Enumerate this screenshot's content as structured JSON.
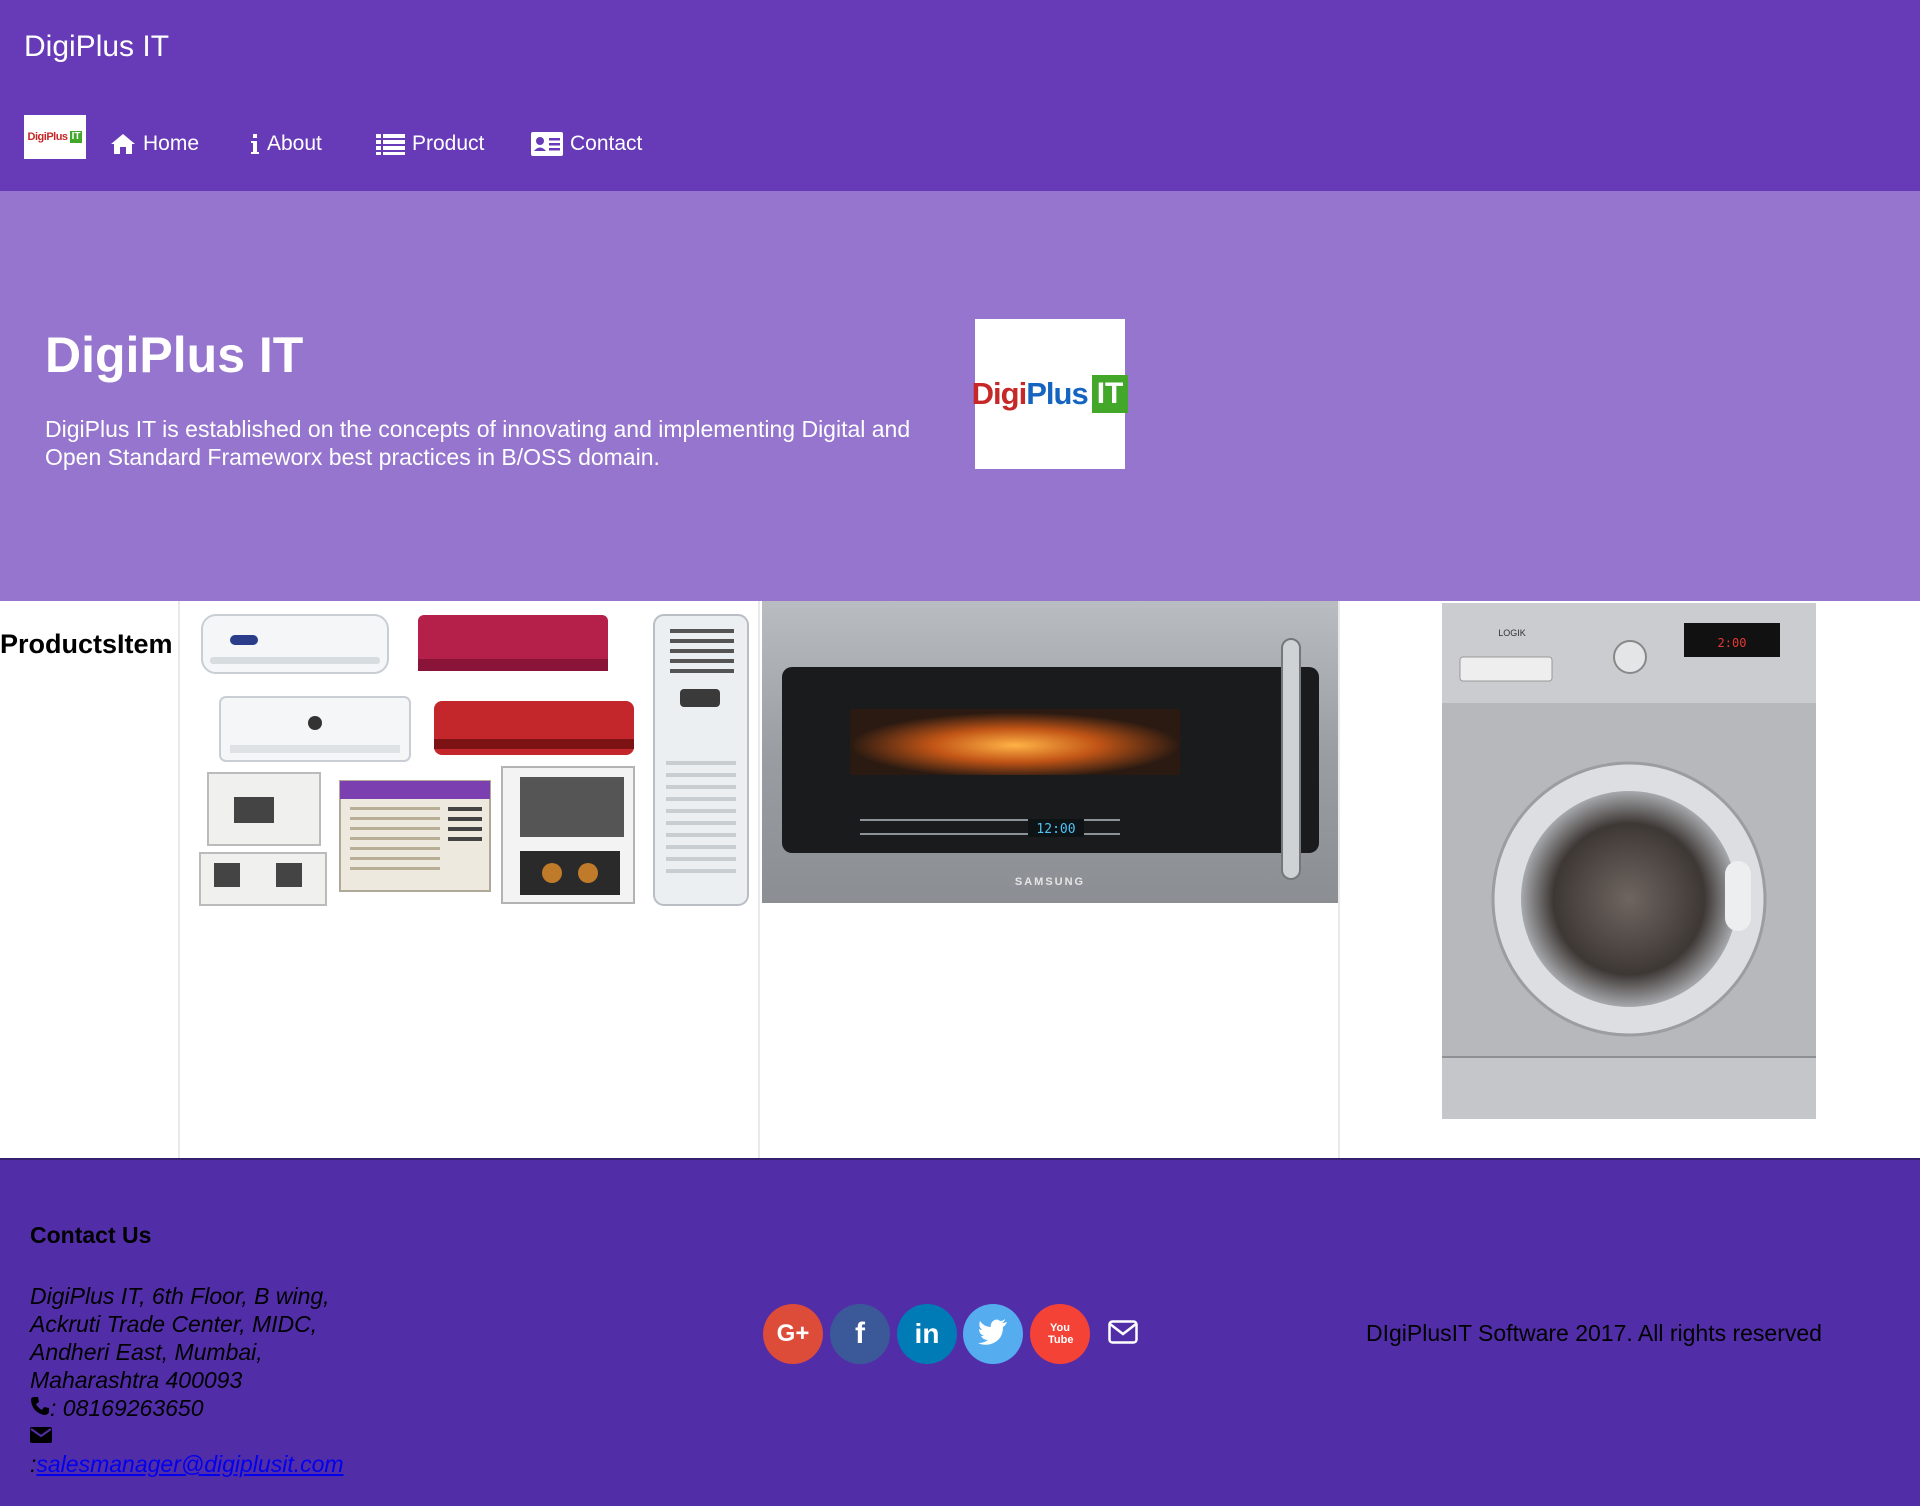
{
  "header": {
    "brand": "DigiPlus IT",
    "logo_text": "DigiPlus",
    "logo_badge": "IT",
    "nav": [
      {
        "label": "Home",
        "icon": "home-icon"
      },
      {
        "label": "About",
        "icon": "info-icon"
      },
      {
        "label": "Product",
        "icon": "list-icon"
      },
      {
        "label": "Contact",
        "icon": "contact-card-icon"
      }
    ]
  },
  "hero": {
    "title": "DigiPlus IT",
    "description": "DigiPlus IT is established on the concepts of innovating and implementing Digital and Open Standard Frameworx best practices in B/OSS domain.",
    "logo_text_a": "Digi",
    "logo_text_b": "Plus",
    "logo_badge": "IT"
  },
  "products": {
    "heading": "ProductsItem",
    "items": [
      {
        "name": "Air conditioners",
        "image": "air-conditioners-image"
      },
      {
        "name": "Microwave oven",
        "image": "microwave-image",
        "brand_label": "SAMSUNG",
        "display": "12:00"
      },
      {
        "name": "Washing machine",
        "image": "washing-machine-image",
        "brand_label": "LOGIK",
        "display": "2:00"
      }
    ]
  },
  "footer": {
    "contact_heading": "Contact Us",
    "address_lines": [
      "DigiPlus IT, 6th Floor, B wing,",
      "Ackruti Trade Center, MIDC,",
      "Andheri East, Mumbai,",
      "Maharashtra 400093"
    ],
    "phone": ": 08169263650",
    "email_prefix": ":",
    "email": "salesmanager@digiplusit.com",
    "social": [
      {
        "name": "google-plus",
        "label": "G+",
        "color": "#dd4b39"
      },
      {
        "name": "facebook",
        "label": "f",
        "color": "#3b5998"
      },
      {
        "name": "linkedin",
        "label": "in",
        "color": "#007bb5"
      },
      {
        "name": "twitter",
        "label": "twitter",
        "color": "#55acee"
      },
      {
        "name": "youtube",
        "label": "You Tube",
        "color": "#f44336"
      }
    ],
    "copyright": "DIgiPlusIT Software 2017. All rights reserved"
  },
  "colors": {
    "header_bg": "#673ab7",
    "hero_bg": "#9575cd",
    "footer_bg": "#512da8"
  }
}
